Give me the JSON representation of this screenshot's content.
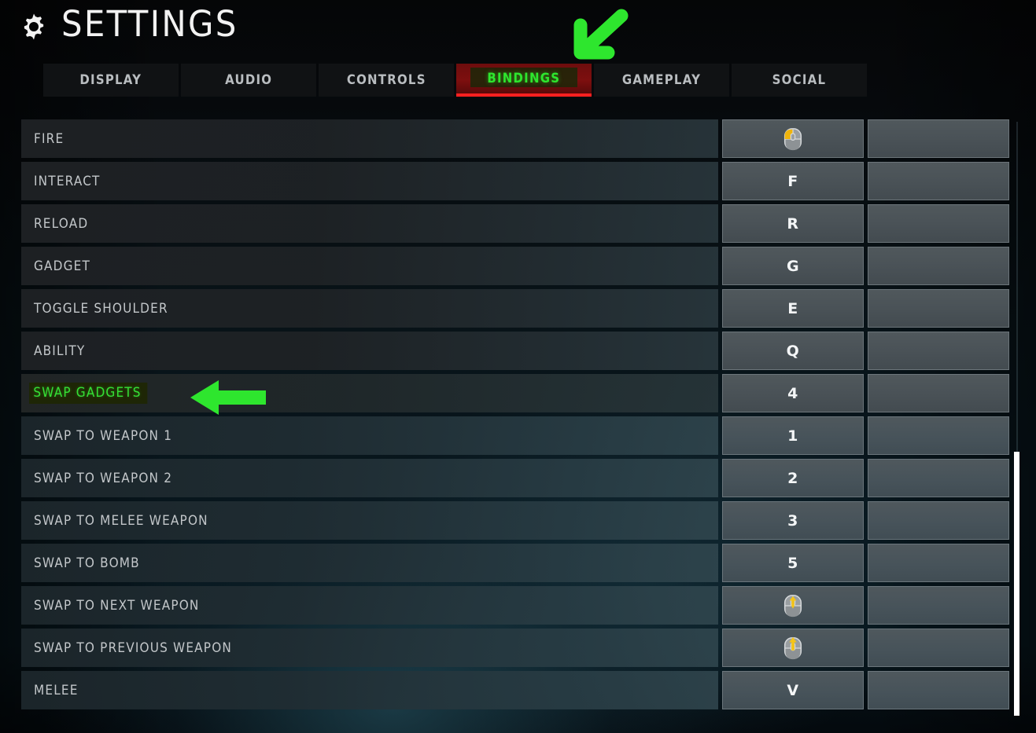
{
  "header": {
    "title": "SETTINGS",
    "gear_icon": "gear-icon"
  },
  "tabs": [
    {
      "label": "DISPLAY",
      "active": false
    },
    {
      "label": "AUDIO",
      "active": false
    },
    {
      "label": "CONTROLS",
      "active": false
    },
    {
      "label": "BINDINGS",
      "active": true
    },
    {
      "label": "GAMEPLAY",
      "active": false
    },
    {
      "label": "SOCIAL",
      "active": false
    }
  ],
  "colors": {
    "active_tab_bg": "#7d0f0f",
    "active_tab_underline": "#ff2020",
    "active_tab_text": "#2ee62e",
    "highlight_text": "#35e035",
    "highlight_bg": "#1e2606",
    "annotation_arrow": "#2ee62e",
    "key_cell_bg": "#4a5257",
    "label_text": "#c3c7ca",
    "scrollbar_thumb": "#ffffff"
  },
  "bindings": [
    {
      "action": "FIRE",
      "primary": "mouse-left-icon",
      "primary_type": "icon",
      "secondary": "",
      "highlighted": false
    },
    {
      "action": "INTERACT",
      "primary": "F",
      "primary_type": "text",
      "secondary": "",
      "highlighted": false
    },
    {
      "action": "RELOAD",
      "primary": "R",
      "primary_type": "text",
      "secondary": "",
      "highlighted": false
    },
    {
      "action": "GADGET",
      "primary": "G",
      "primary_type": "text",
      "secondary": "",
      "highlighted": false
    },
    {
      "action": "TOGGLE SHOULDER",
      "primary": "E",
      "primary_type": "text",
      "secondary": "",
      "highlighted": false
    },
    {
      "action": "ABILITY",
      "primary": "Q",
      "primary_type": "text",
      "secondary": "",
      "highlighted": false
    },
    {
      "action": "SWAP GADGETS",
      "primary": "4",
      "primary_type": "text",
      "secondary": "",
      "highlighted": true
    },
    {
      "action": "SWAP TO WEAPON 1",
      "primary": "1",
      "primary_type": "text",
      "secondary": "",
      "highlighted": false
    },
    {
      "action": "SWAP TO WEAPON 2",
      "primary": "2",
      "primary_type": "text",
      "secondary": "",
      "highlighted": false
    },
    {
      "action": "SWAP TO MELEE WEAPON",
      "primary": "3",
      "primary_type": "text",
      "secondary": "",
      "highlighted": false
    },
    {
      "action": "SWAP TO BOMB",
      "primary": "5",
      "primary_type": "text",
      "secondary": "",
      "highlighted": false
    },
    {
      "action": "SWAP TO NEXT WEAPON",
      "primary": "mouse-wheel-down-icon",
      "primary_type": "icon",
      "secondary": "",
      "highlighted": false
    },
    {
      "action": "SWAP TO PREVIOUS WEAPON",
      "primary": "mouse-wheel-up-icon",
      "primary_type": "icon",
      "secondary": "",
      "highlighted": false
    },
    {
      "action": "MELEE",
      "primary": "V",
      "primary_type": "text",
      "secondary": "",
      "highlighted": false
    }
  ],
  "annotations": [
    {
      "name": "arrow-pointing-to-bindings-tab",
      "direction": "down-left"
    },
    {
      "name": "arrow-pointing-to-swap-gadgets-row",
      "direction": "left"
    }
  ],
  "scrollbar": {
    "name": "vertical-scrollbar"
  }
}
